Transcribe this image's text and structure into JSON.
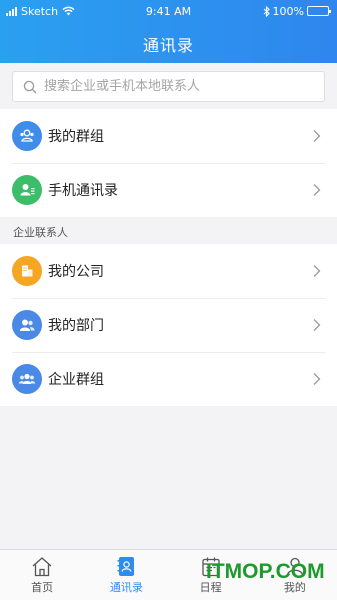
{
  "status_bar": {
    "carrier": "Sketch",
    "time": "9:41 AM",
    "battery": "100%"
  },
  "header": {
    "title": "通讯录"
  },
  "search": {
    "placeholder": "搜索企业或手机本地联系人"
  },
  "personal": [
    {
      "label": "我的群组",
      "icon": "group-icon",
      "color": "#3f8de9"
    },
    {
      "label": "手机通讯录",
      "icon": "contacts-icon",
      "color": "#3bbd6a"
    }
  ],
  "section_title": "企业联系人",
  "enterprise": [
    {
      "label": "我的公司",
      "icon": "building-icon",
      "color": "#f5a623"
    },
    {
      "label": "我的部门",
      "icon": "department-icon",
      "color": "#4a89e6"
    },
    {
      "label": "企业群组",
      "icon": "enterprise-group-icon",
      "color": "#4a89e6"
    }
  ],
  "tabs": [
    {
      "label": "首页",
      "icon": "home-icon",
      "active": false
    },
    {
      "label": "通讯录",
      "icon": "contacts-book-icon",
      "active": true
    },
    {
      "label": "日程",
      "icon": "calendar-icon",
      "active": false
    },
    {
      "label": "我的",
      "icon": "profile-icon",
      "active": false
    }
  ],
  "colors": {
    "accent": "#2f8cee",
    "header_gradient_start": "#2aa0f0",
    "header_gradient_end": "#2f86ee"
  },
  "watermark": "ITMOP.COM"
}
